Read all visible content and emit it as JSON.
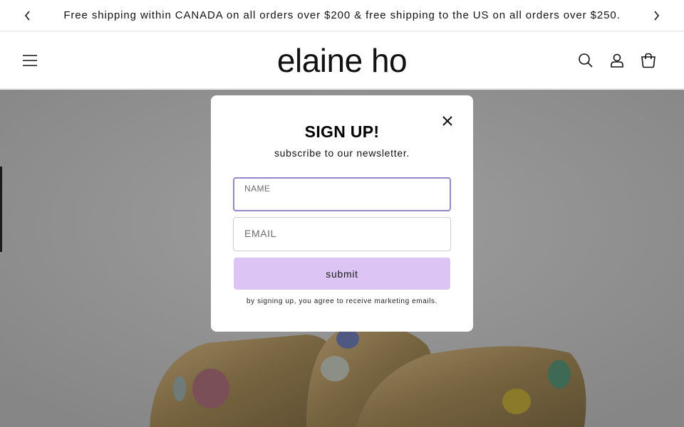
{
  "announcement": {
    "text": "Free shipping within CANADA on all orders over $200 & free shipping to the US on all orders over $250.",
    "prev_icon": "chevron-left-icon",
    "next_icon": "chevron-right-icon"
  },
  "header": {
    "logo": "elaine ho",
    "menu_icon": "hamburger-menu-icon",
    "search_icon": "search-icon",
    "account_icon": "account-icon",
    "cart_icon": "cart-icon"
  },
  "hero": {
    "image": "gold rings with colored gemstones"
  },
  "modal": {
    "title": "SIGN UP!",
    "subtitle": "subscribe to our newsletter.",
    "close_icon": "close-icon",
    "name_label": "NAME",
    "name_value": "",
    "email_label": "EMAIL",
    "email_value": "",
    "submit_label": "submit",
    "disclaimer": "by signing up, you agree to receive marketing emails."
  },
  "colors": {
    "accent": "#dcc5f5",
    "focus_border": "#9a86c9",
    "text": "#121212"
  }
}
